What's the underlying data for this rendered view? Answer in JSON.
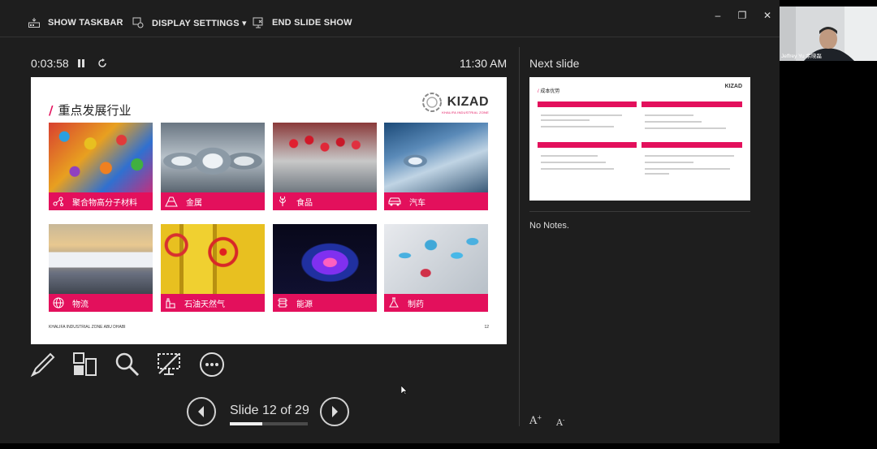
{
  "toolbar": {
    "show_taskbar": "SHOW TASKBAR",
    "display_settings": "DISPLAY SETTINGS ▾",
    "end_slide_show": "END SLIDE SHOW"
  },
  "timer": "0:03:58",
  "clock": "11:30 AM",
  "slide": {
    "title": "重点发展行业",
    "brand": "KIZAD",
    "brand_sub": "KHALIFA INDUSTRIAL ZONE",
    "footer": "KHALIFA INDUSTRIAL ZONE ABU DHABI",
    "page": "12",
    "tiles": [
      {
        "label": "聚合物高分子材料",
        "icon": "molecule-icon"
      },
      {
        "label": "金属",
        "icon": "metal-bars-icon"
      },
      {
        "label": "食品",
        "icon": "wheat-icon"
      },
      {
        "label": "汽车",
        "icon": "car-icon"
      },
      {
        "label": "物流",
        "icon": "globe-icon"
      },
      {
        "label": "石油天然气",
        "icon": "oil-pump-icon"
      },
      {
        "label": "能源",
        "icon": "energy-icon"
      },
      {
        "label": "制药",
        "icon": "flask-icon"
      }
    ]
  },
  "navigation": {
    "slide_label": "Slide 12 of 29",
    "progress_fraction": 0.414
  },
  "next_slide_label": "Next slide",
  "next_slide": {
    "title": "成本优势",
    "brand": "KIZAD"
  },
  "notes": "No Notes.",
  "participant": {
    "name": "Jeffrey Yu 余晓磊"
  },
  "colors": {
    "accent": "#e3105c",
    "background": "#1e1e1e"
  }
}
